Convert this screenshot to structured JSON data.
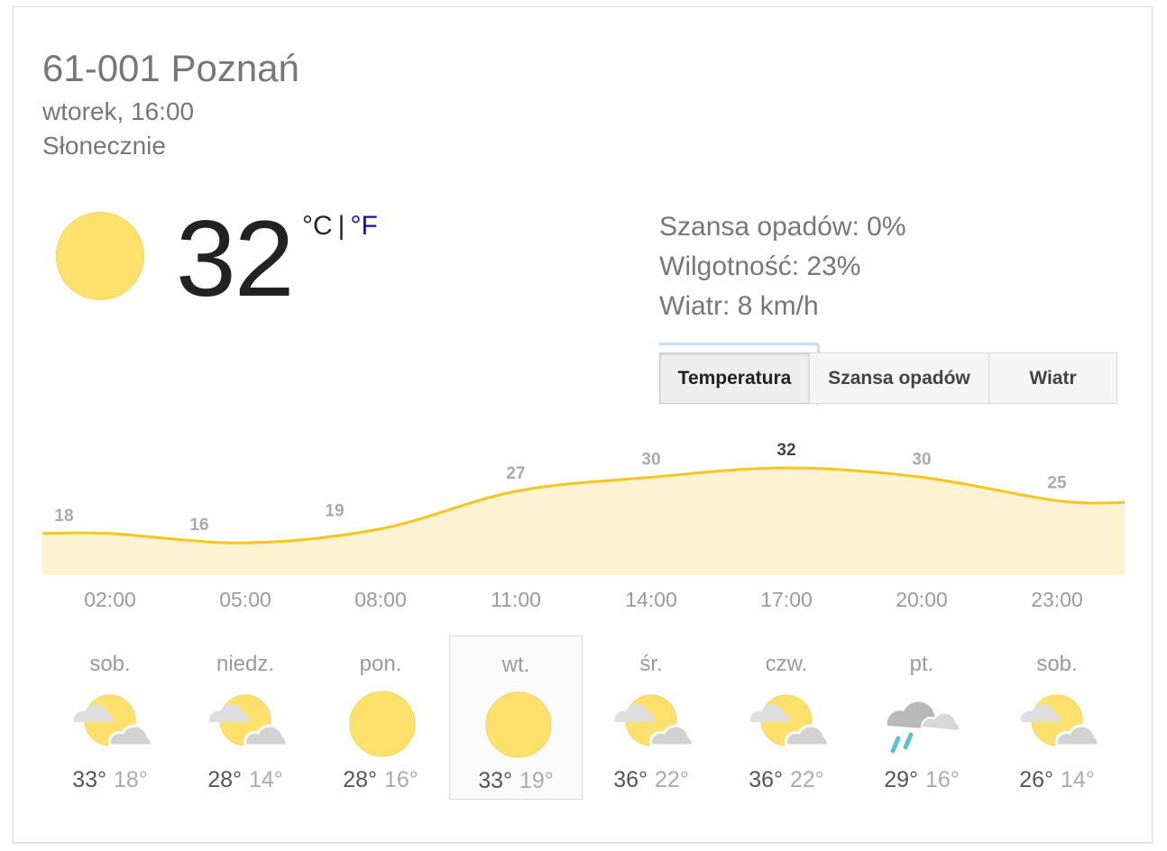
{
  "location": "61-001 Poznań",
  "datetime": "wtorek, 16:00",
  "condition": "Słonecznie",
  "current": {
    "icon": "sun-icon",
    "temperature": "32",
    "unit_c": "°C",
    "unit_sep": "|",
    "unit_f": "°F"
  },
  "details": {
    "precip": "Szansa opadów: 0%",
    "humidity": "Wilgotność: 23%",
    "wind": "Wiatr: 8 km/h"
  },
  "tabs": [
    {
      "label": "Temperatura"
    },
    {
      "label": "Szansa opadów"
    },
    {
      "label": "Wiatr"
    }
  ],
  "chart_data": {
    "type": "area",
    "x": [
      "02:00",
      "05:00",
      "08:00",
      "11:00",
      "14:00",
      "17:00",
      "20:00",
      "23:00"
    ],
    "series": [
      {
        "values": [
          18,
          16,
          19,
          27,
          30,
          32,
          30,
          25
        ]
      }
    ],
    "data_labels": [
      "18",
      "16",
      "19",
      "27",
      "30",
      "32",
      "30",
      "25"
    ],
    "highlight_index": 5,
    "colors": {
      "line": "#f6c51e",
      "fill": "#fdf3d2",
      "label": "#aaaaaa",
      "highlight": "#444444"
    },
    "grid": false
  },
  "days": [
    {
      "name": "sob.",
      "icon": "partly-cloudy-icon",
      "high": "33°",
      "low": "18°"
    },
    {
      "name": "niedz.",
      "icon": "partly-cloudy-icon",
      "high": "28°",
      "low": "14°"
    },
    {
      "name": "pon.",
      "icon": "sun-icon",
      "high": "28°",
      "low": "16°"
    },
    {
      "name": "wt.",
      "icon": "sun-icon",
      "high": "33°",
      "low": "19°",
      "selected": true
    },
    {
      "name": "śr.",
      "icon": "partly-cloudy-icon",
      "high": "36°",
      "low": "22°"
    },
    {
      "name": "czw.",
      "icon": "partly-cloudy-icon",
      "high": "36°",
      "low": "22°"
    },
    {
      "name": "pt.",
      "icon": "rain-icon",
      "high": "29°",
      "low": "16°"
    },
    {
      "name": "sob.",
      "icon": "partly-cloudy-icon",
      "high": "26°",
      "low": "14°"
    }
  ]
}
